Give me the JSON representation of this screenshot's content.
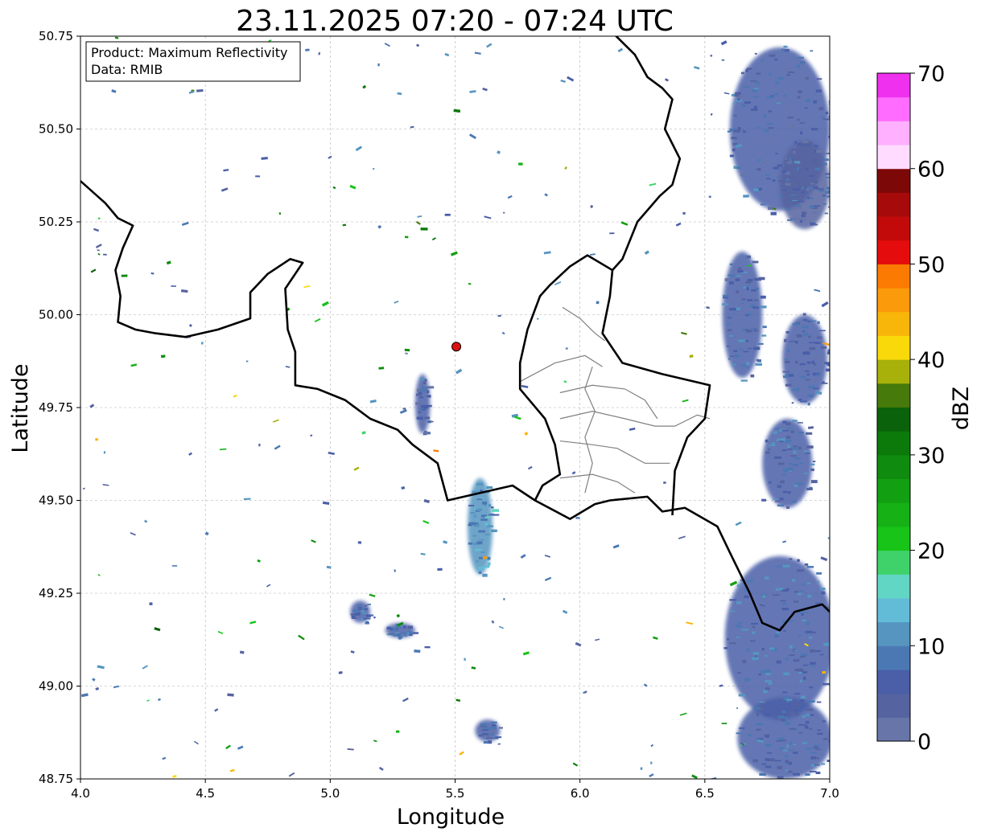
{
  "title": "23.11.2025 07:20 - 07:24 UTC",
  "info_box": {
    "product": "Product: Maximum Reflectivity",
    "source": "Data: RMIB"
  },
  "axes": {
    "xlabel": "Longitude",
    "ylabel": "Latitude",
    "xlim": [
      4.0,
      7.0
    ],
    "ylim": [
      48.75,
      50.75
    ],
    "xticks": [
      "4.0",
      "4.5",
      "5.0",
      "5.5",
      "6.0",
      "6.5",
      "7.0"
    ],
    "yticks": [
      "48.75",
      "49.00",
      "49.25",
      "49.50",
      "49.75",
      "50.00",
      "50.25",
      "50.50",
      "50.75"
    ],
    "grid": true
  },
  "radar_site": {
    "lon": 5.505,
    "lat": 49.914,
    "color": "#dd1111"
  },
  "colorbar": {
    "label": "dBZ",
    "ticks": [
      "0",
      "10",
      "20",
      "30",
      "40",
      "50",
      "60",
      "70"
    ],
    "colors": [
      "#6775a8",
      "#5563a0",
      "#4a5fa8",
      "#4b78b3",
      "#5595c0",
      "#62bcd8",
      "#62d6c4",
      "#3fd26a",
      "#17c417",
      "#15b115",
      "#12a012",
      "#0f8c0f",
      "#0b7a0b",
      "#0a620a",
      "#467a0b",
      "#a8b00a",
      "#f9d90a",
      "#f9b60a",
      "#fb9a0a",
      "#fb7b02",
      "#e40c0c",
      "#c20a0a",
      "#a60a0a",
      "#7d0808",
      "#ffdcff",
      "#ffb0ff",
      "#ff6cff",
      "#ef30ef"
    ]
  },
  "echo_areas": [
    {
      "lon": 6.8,
      "lat": 50.5,
      "rx": 0.2,
      "ry": 0.22,
      "dbz": 5
    },
    {
      "lon": 6.9,
      "lat": 50.35,
      "rx": 0.1,
      "ry": 0.12,
      "dbz": 4
    },
    {
      "lon": 6.65,
      "lat": 50.0,
      "rx": 0.08,
      "ry": 0.17,
      "dbz": 6
    },
    {
      "lon": 6.9,
      "lat": 49.88,
      "rx": 0.09,
      "ry": 0.12,
      "dbz": 5
    },
    {
      "lon": 6.83,
      "lat": 49.6,
      "rx": 0.1,
      "ry": 0.12,
      "dbz": 6
    },
    {
      "lon": 6.8,
      "lat": 49.13,
      "rx": 0.22,
      "ry": 0.22,
      "dbz": 7
    },
    {
      "lon": 6.82,
      "lat": 48.86,
      "rx": 0.19,
      "ry": 0.11,
      "dbz": 6
    },
    {
      "lon": 5.6,
      "lat": 49.43,
      "rx": 0.05,
      "ry": 0.13,
      "dbz": 10
    },
    {
      "lon": 5.37,
      "lat": 49.76,
      "rx": 0.03,
      "ry": 0.08,
      "dbz": 5
    },
    {
      "lon": 5.12,
      "lat": 49.2,
      "rx": 0.04,
      "ry": 0.03,
      "dbz": 6
    },
    {
      "lon": 5.63,
      "lat": 48.88,
      "rx": 0.05,
      "ry": 0.03,
      "dbz": 5
    },
    {
      "lon": 5.28,
      "lat": 49.15,
      "rx": 0.06,
      "ry": 0.02,
      "dbz": 6
    }
  ],
  "country_borders": [
    [
      [
        4.0,
        50.36
      ],
      [
        4.1,
        50.3
      ],
      [
        4.15,
        50.26
      ],
      [
        4.21,
        50.24
      ],
      [
        4.17,
        50.18
      ],
      [
        4.14,
        50.12
      ],
      [
        4.16,
        50.05
      ],
      [
        4.15,
        49.98
      ],
      [
        4.22,
        49.96
      ],
      [
        4.3,
        49.95
      ],
      [
        4.42,
        49.94
      ],
      [
        4.55,
        49.96
      ],
      [
        4.68,
        49.99
      ],
      [
        4.68,
        50.06
      ],
      [
        4.75,
        50.11
      ],
      [
        4.84,
        50.15
      ],
      [
        4.89,
        50.14
      ],
      [
        4.82,
        50.07
      ],
      [
        4.83,
        49.96
      ],
      [
        4.86,
        49.9
      ],
      [
        4.86,
        49.81
      ],
      [
        4.95,
        49.8
      ],
      [
        5.06,
        49.77
      ],
      [
        5.16,
        49.72
      ],
      [
        5.27,
        49.69
      ],
      [
        5.33,
        49.65
      ],
      [
        5.43,
        49.6
      ],
      [
        5.47,
        49.5
      ],
      [
        5.6,
        49.52
      ],
      [
        5.73,
        49.54
      ],
      [
        5.82,
        49.5
      ],
      [
        5.96,
        49.45
      ],
      [
        6.06,
        49.49
      ],
      [
        6.12,
        49.5
      ],
      [
        6.27,
        49.51
      ],
      [
        6.33,
        49.47
      ],
      [
        6.42,
        49.48
      ],
      [
        6.55,
        49.43
      ],
      [
        6.6,
        49.36
      ],
      [
        6.68,
        49.25
      ],
      [
        6.73,
        49.17
      ],
      [
        6.8,
        49.15
      ],
      [
        6.86,
        49.2
      ],
      [
        6.97,
        49.22
      ],
      [
        7.0,
        49.2
      ]
    ],
    [
      [
        6.13,
        50.76
      ],
      [
        6.22,
        50.7
      ],
      [
        6.27,
        50.64
      ],
      [
        6.33,
        50.61
      ],
      [
        6.37,
        50.58
      ],
      [
        6.34,
        50.5
      ],
      [
        6.4,
        50.42
      ],
      [
        6.37,
        50.35
      ],
      [
        6.32,
        50.32
      ],
      [
        6.23,
        50.25
      ],
      [
        6.17,
        50.15
      ],
      [
        6.13,
        50.12
      ],
      [
        6.12,
        50.05
      ],
      [
        6.09,
        49.95
      ],
      [
        6.17,
        49.87
      ],
      [
        6.33,
        49.84
      ],
      [
        6.52,
        49.81
      ],
      [
        6.5,
        49.72
      ],
      [
        6.43,
        49.67
      ],
      [
        6.38,
        49.58
      ],
      [
        6.37,
        49.46
      ]
    ],
    [
      [
        6.13,
        50.12
      ],
      [
        6.03,
        50.16
      ],
      [
        5.96,
        50.13
      ],
      [
        5.88,
        50.08
      ],
      [
        5.84,
        50.05
      ],
      [
        5.79,
        49.96
      ],
      [
        5.76,
        49.87
      ],
      [
        5.76,
        49.8
      ],
      [
        5.86,
        49.72
      ],
      [
        5.9,
        49.65
      ],
      [
        5.92,
        49.57
      ],
      [
        5.85,
        49.54
      ],
      [
        5.82,
        49.5
      ]
    ]
  ],
  "district_lines": [
    [
      [
        5.93,
        50.02
      ],
      [
        6.0,
        49.99
      ],
      [
        6.06,
        49.95
      ],
      [
        6.1,
        49.93
      ]
    ],
    [
      [
        5.76,
        49.82
      ],
      [
        5.9,
        49.87
      ],
      [
        6.02,
        49.89
      ],
      [
        6.09,
        49.86
      ]
    ],
    [
      [
        5.92,
        49.79
      ],
      [
        6.05,
        49.81
      ],
      [
        6.18,
        49.8
      ],
      [
        6.26,
        49.77
      ],
      [
        6.31,
        49.72
      ]
    ],
    [
      [
        5.92,
        49.72
      ],
      [
        6.05,
        49.74
      ],
      [
        6.18,
        49.72
      ],
      [
        6.3,
        49.7
      ],
      [
        6.38,
        49.7
      ],
      [
        6.47,
        49.73
      ],
      [
        6.52,
        49.72
      ]
    ],
    [
      [
        5.92,
        49.66
      ],
      [
        6.05,
        49.65
      ],
      [
        6.15,
        49.64
      ],
      [
        6.26,
        49.6
      ],
      [
        6.36,
        49.6
      ]
    ],
    [
      [
        5.92,
        49.56
      ],
      [
        6.05,
        49.57
      ],
      [
        6.15,
        49.55
      ],
      [
        6.22,
        49.52
      ]
    ],
    [
      [
        6.05,
        49.86
      ],
      [
        6.02,
        49.8
      ],
      [
        6.06,
        49.74
      ],
      [
        6.02,
        49.67
      ],
      [
        6.05,
        49.6
      ],
      [
        6.02,
        49.52
      ]
    ]
  ]
}
